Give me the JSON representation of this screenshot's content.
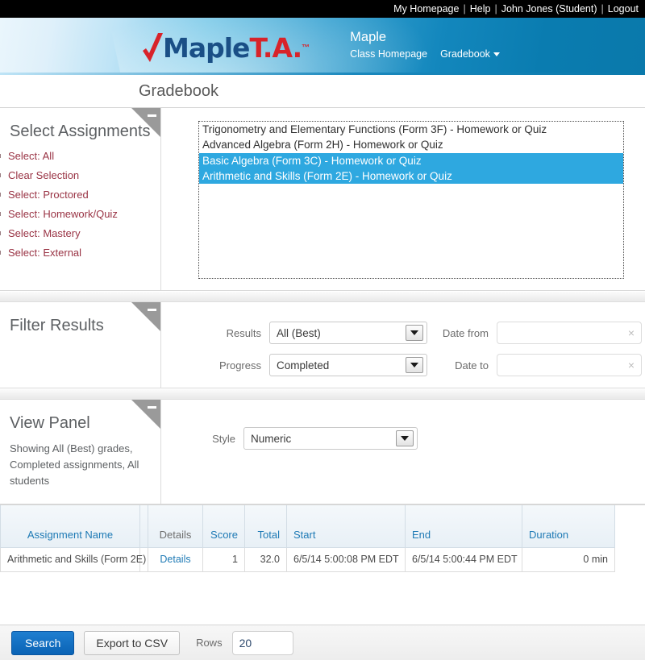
{
  "topnav": {
    "links": [
      {
        "label": "My Homepage"
      },
      {
        "label": "Help"
      },
      {
        "label": "John Jones (Student)"
      },
      {
        "label": "Logout"
      }
    ],
    "separator": "|"
  },
  "brand": {
    "maple": "Maple",
    "ta": "T.A.",
    "tm": "™",
    "check_icon": "check-icon"
  },
  "banner": {
    "class_name": "Maple",
    "nav": [
      {
        "label": "Class Homepage",
        "has_caret": false
      },
      {
        "label": "Gradebook",
        "has_caret": true
      }
    ]
  },
  "page": {
    "title": "Gradebook"
  },
  "select_assignments": {
    "heading": "Select Assignments",
    "links": [
      {
        "label": "Select: All"
      },
      {
        "label": "Clear Selection"
      },
      {
        "label": "Select: Proctored"
      },
      {
        "label": "Select: Homework/Quiz"
      },
      {
        "label": "Select: Mastery"
      },
      {
        "label": "Select: External"
      }
    ],
    "assignments": [
      {
        "label": "Trigonometry and Elementary Functions (Form 3F) - Homework or Quiz",
        "selected": false
      },
      {
        "label": "Advanced Algebra (Form 2H) - Homework or Quiz",
        "selected": false
      },
      {
        "label": "Basic Algebra (Form 3C) - Homework or Quiz",
        "selected": true
      },
      {
        "label": "Arithmetic and Skills (Form 2E) - Homework or Quiz",
        "selected": true
      }
    ]
  },
  "filter_results": {
    "heading": "Filter Results",
    "results_label": "Results",
    "results_value": "All (Best)",
    "progress_label": "Progress",
    "progress_value": "Completed",
    "date_from_label": "Date from",
    "date_from_value": "",
    "date_from_placeholder": "",
    "date_to_label": "Date to",
    "date_to_value": "",
    "date_to_placeholder": "",
    "clear_icon": "×"
  },
  "view_panel": {
    "heading": "View Panel",
    "summary": "Showing All (Best) grades, Completed assignments, All students",
    "style_label": "Style",
    "style_value": "Numeric"
  },
  "results_table": {
    "columns": [
      {
        "key": "assignment_name",
        "label": "Assignment Name",
        "align": "left"
      },
      {
        "key": "details",
        "label": "Details",
        "align": "center"
      },
      {
        "key": "score",
        "label": "Score",
        "align": "right"
      },
      {
        "key": "total",
        "label": "Total",
        "align": "right"
      },
      {
        "key": "start",
        "label": "Start",
        "align": "left"
      },
      {
        "key": "end",
        "label": "End",
        "align": "left"
      },
      {
        "key": "duration",
        "label": "Duration",
        "align": "right"
      }
    ],
    "rows": [
      {
        "assignment_name": "Arithmetic and Skills (Form 2E)",
        "details": "Details",
        "score": "1",
        "total": "32.0",
        "start": "6/5/14 5:00:08 PM EDT",
        "end": "6/5/14 5:00:44 PM EDT",
        "duration": "0 min"
      }
    ]
  },
  "actionbar": {
    "search_label": "Search",
    "export_label": "Export to CSV",
    "rows_label": "Rows",
    "rows_value": "20"
  },
  "colors": {
    "accent_blue": "#1e7ab5",
    "selection_blue": "#2ea8e0",
    "link_red": "#993344",
    "primary_button": "#0a63b5",
    "banner_blue": "#0a79ab"
  },
  "panel_toggle": {
    "icon": "collapse-minus-icon"
  }
}
